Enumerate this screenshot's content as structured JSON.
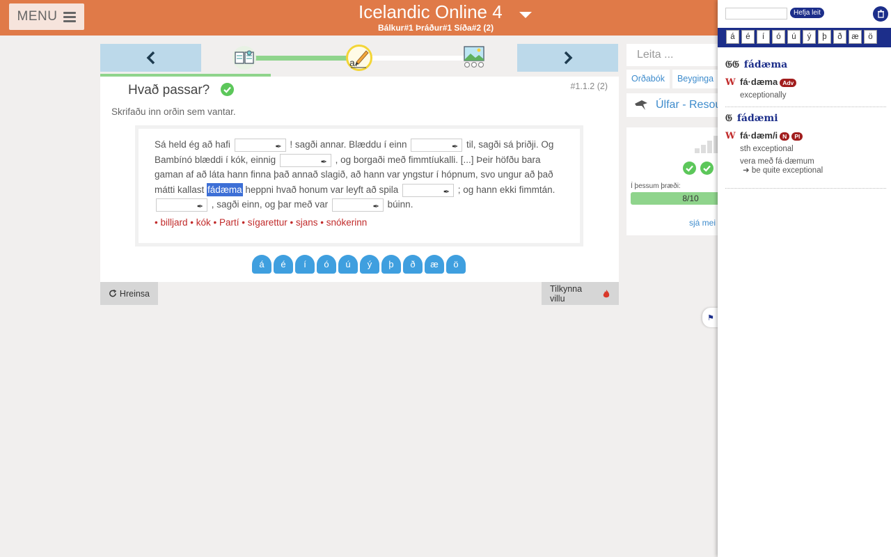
{
  "header": {
    "menu_label": "MENU",
    "title": "Icelandic Online 4",
    "subtitle": "Bálkur#1 Þráður#1 Síða#2 (2)"
  },
  "exercise": {
    "title": "Hvað passar?",
    "id": "#1.1.2 (2)",
    "instruction": "Skrifaðu inn orðin sem vantar.",
    "text": {
      "p1": "Sá held ég að hafi",
      "p2": "! sagði annar. Blæddu í einn",
      "p3": "til, sagði sá þriðji. Og Bambínó blæddi í kók, einnig",
      "p4": ", og borgaði með fimmtíukalli. [...] Þeir höfðu bara gaman af að láta hann finna það annað slagið, að hann var yngstur í hópnum, svo ungur að það mátti kallast",
      "highlight": "fádæma",
      "p5": "heppni hvað honum var leyft að spila",
      "p6": "; og hann ekki fimmtán.",
      "p7": ", sagði einn, og þar með var",
      "p8": "búinn."
    },
    "wordbank": "• billjard • kók • Partí • sígarettur • sjans • snókerinn",
    "chars": [
      "á",
      "é",
      "í",
      "ó",
      "ú",
      "ý",
      "þ",
      "ð",
      "æ",
      "ö"
    ],
    "clear_label": "Hreinsa",
    "report_label": "Tilkynna villu"
  },
  "sidebar": {
    "search_placeholder": "Leita ...",
    "tabs": [
      "Orðabók",
      "Beyginga"
    ],
    "resources_label": "Úlfar - Resou",
    "stats_label": "Í þessum þræði:",
    "progress": "8/10",
    "more_label": "sjá mei"
  },
  "dictionary": {
    "search_button": "Hefja leit",
    "chars": [
      "á",
      "é",
      "í",
      "ó",
      "ú",
      "ý",
      "þ",
      "ð",
      "æ",
      "ö"
    ],
    "entries": [
      {
        "headword": "fádæma",
        "lemma": "fá·dæma",
        "tag": "Adv",
        "gloss": "exceptionally"
      },
      {
        "headword": "fádæmi",
        "lemma": "fá·dæm/i",
        "tags": [
          "N",
          "Pl"
        ],
        "gloss": "sth exceptional",
        "example": "vera með fá·dæmum",
        "example_gloss": "be quite exceptional"
      }
    ]
  }
}
